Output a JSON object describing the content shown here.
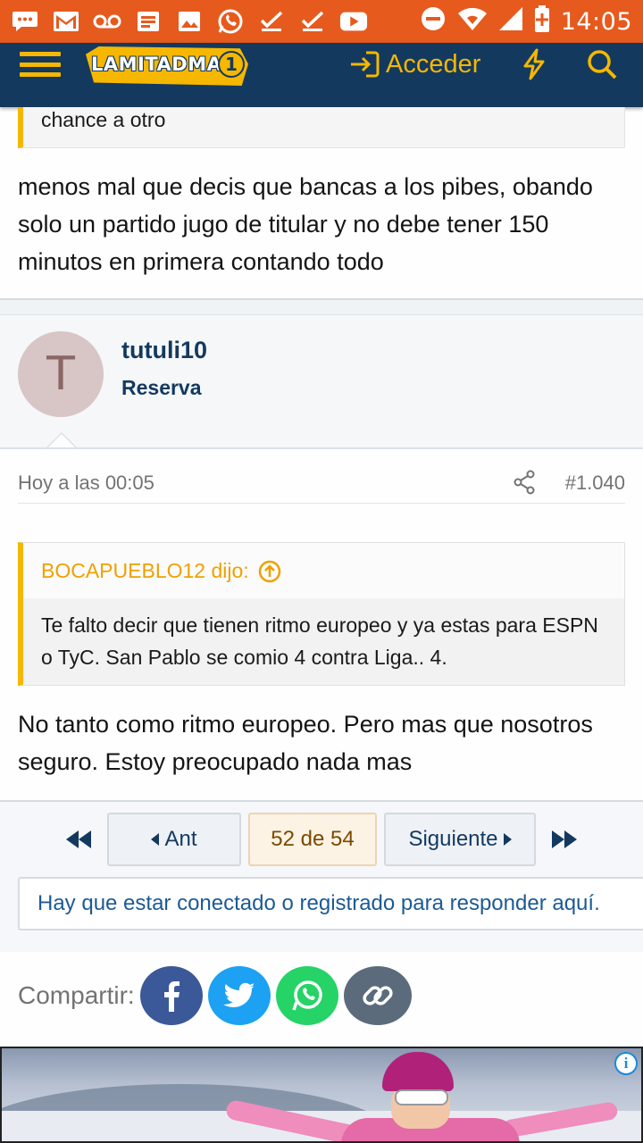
{
  "status_bar": {
    "time": "14:05",
    "icons": [
      "chat-icon",
      "gmail-icon",
      "voicemail-icon",
      "news-icon",
      "image-icon",
      "whatsapp-icon",
      "check-icon",
      "check-icon",
      "youtube-icon",
      "dnd-icon",
      "wifi-icon",
      "signal-icon",
      "battery-icon"
    ]
  },
  "header": {
    "logo_text": "LAMITADMAS",
    "logo_number": "1",
    "login_label": "Acceder",
    "accent_color": "#f5b700",
    "bg_color": "#13395f"
  },
  "previous_post": {
    "quote_tail": "chance a otro",
    "body": "menos mal que decis que bancas a los pibes, obando solo un partido jugo de titular y no debe tener 150 minutos en primera contando todo"
  },
  "post": {
    "avatar_letter": "T",
    "username": "tutuli10",
    "user_title": "Reserva",
    "date": "Hoy a las 00:05",
    "number": "#1.040",
    "quote": {
      "author": "BOCAPUEBLO12 dijo:",
      "text": "Te falto decir que tienen ritmo europeo y ya estas para ESPN o TyC. San Pablo se comio 4 contra Liga.. 4."
    },
    "body": "No tanto como ritmo europeo. Pero mas que nosotros seguro. Estoy preocupado nada mas"
  },
  "pagination": {
    "prev_label": "Ant",
    "current_label": "52 de 54",
    "next_label": "Siguiente"
  },
  "login_notice": "Hay que estar conectado o registrado para responder aquí.",
  "share": {
    "label": "Compartir:",
    "buttons": [
      "facebook-icon",
      "twitter-icon",
      "whatsapp-icon",
      "link-icon"
    ]
  }
}
